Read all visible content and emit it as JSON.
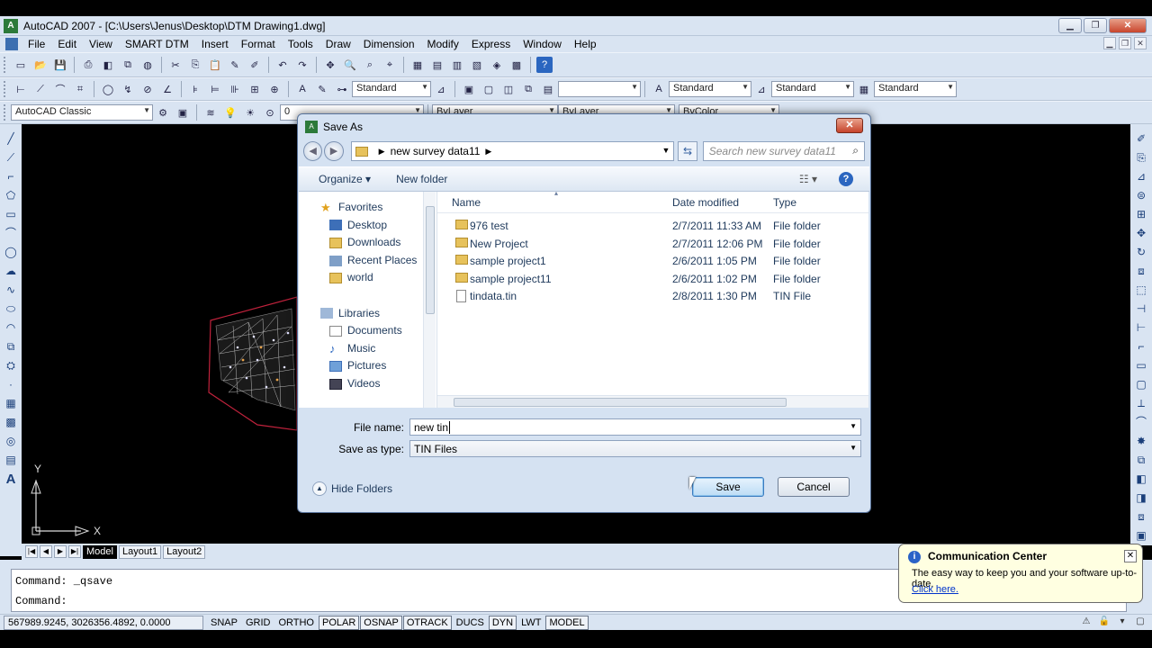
{
  "window": {
    "title": "AutoCAD 2007 - [C:\\Users\\Jenus\\Desktop\\DTM Drawing1.dwg]"
  },
  "menu": [
    "File",
    "Edit",
    "View",
    "SMART DTM",
    "Insert",
    "Format",
    "Tools",
    "Draw",
    "Dimension",
    "Modify",
    "Express",
    "Window",
    "Help"
  ],
  "toolbar2": {
    "text_style": "Standard",
    "dim_style": "Standard",
    "table_style": "Standard",
    "ml_style": "Standard",
    "empty_combo": ""
  },
  "toolbar3": {
    "workspace": "AutoCAD Classic",
    "layer": "0",
    "color": "ByLayer",
    "linetype": "ByLayer",
    "lineweight": "ByColor"
  },
  "dialog": {
    "title": "Save As",
    "breadcrumb": "new survey data11",
    "search_placeholder": "Search new survey data11",
    "organize": "Organize",
    "new_folder": "New folder",
    "nav": {
      "favorites_label": "Favorites",
      "favorites": [
        "Desktop",
        "Downloads",
        "Recent Places",
        "world"
      ],
      "libraries_label": "Libraries",
      "libraries": [
        "Documents",
        "Music",
        "Pictures",
        "Videos"
      ]
    },
    "columns": {
      "name": "Name",
      "date": "Date modified",
      "type": "Type"
    },
    "files": [
      {
        "name": "976 test",
        "date": "2/7/2011 11:33 AM",
        "type": "File folder",
        "kind": "folder"
      },
      {
        "name": "New Project",
        "date": "2/7/2011 12:06 PM",
        "type": "File folder",
        "kind": "folder"
      },
      {
        "name": "sample project1",
        "date": "2/6/2011 1:05 PM",
        "type": "File folder",
        "kind": "folder"
      },
      {
        "name": "sample project11",
        "date": "2/6/2011 1:02 PM",
        "type": "File folder",
        "kind": "folder"
      },
      {
        "name": "tindata.tin",
        "date": "2/8/2011 1:30 PM",
        "type": "TIN File",
        "kind": "file"
      }
    ],
    "file_name_label": "File name:",
    "file_name_value": "new tin",
    "save_type_label": "Save as type:",
    "save_type_value": "TIN Files",
    "hide_folders": "Hide Folders",
    "save": "Save",
    "cancel": "Cancel"
  },
  "ucs": {
    "x": "X",
    "y": "Y"
  },
  "layout_tabs": [
    "Model",
    "Layout1",
    "Layout2"
  ],
  "command": {
    "line1": "Command: _qsave",
    "line2": "Command:"
  },
  "status": {
    "coords": "567989.9245, 3026356.4892, 0.0000",
    "buttons": [
      "SNAP",
      "GRID",
      "ORTHO",
      "POLAR",
      "OSNAP",
      "OTRACK",
      "DUCS",
      "DYN",
      "LWT",
      "MODEL"
    ]
  },
  "notification": {
    "title": "Communication Center",
    "message": "The easy way to keep you and your software up-to-date.",
    "link": "Click here."
  }
}
